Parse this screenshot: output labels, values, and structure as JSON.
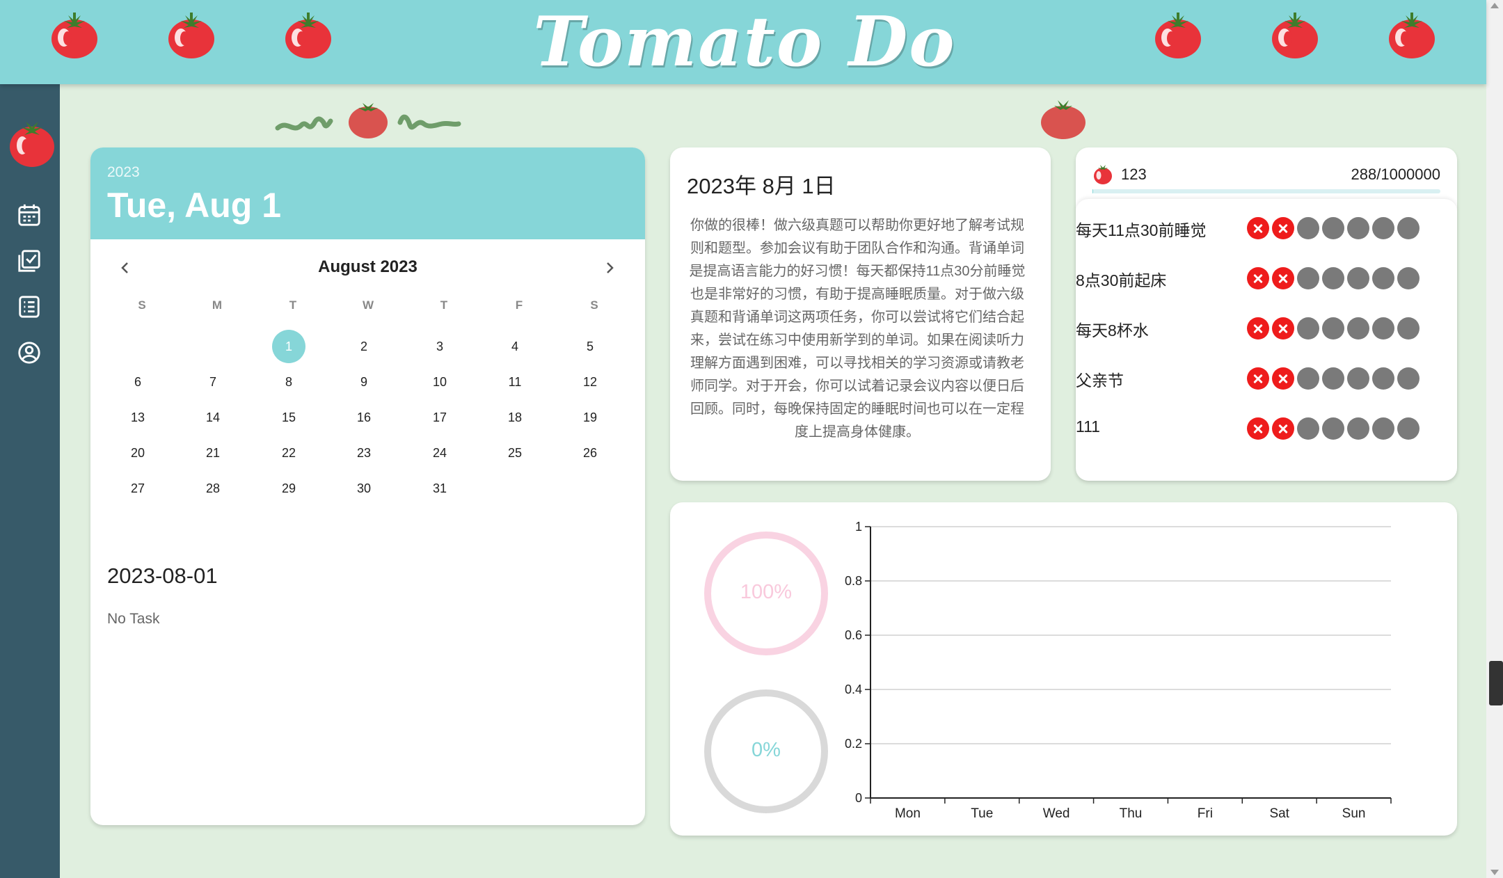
{
  "header": {
    "brand": "Tomato Do"
  },
  "sidebar": {
    "items": [
      {
        "icon": "calendar-icon"
      },
      {
        "icon": "checklist-icon"
      },
      {
        "icon": "list-icon"
      },
      {
        "icon": "user-icon"
      }
    ]
  },
  "calendar": {
    "year": "2023",
    "date_display": "Tue, Aug 1",
    "month_label": "August 2023",
    "weekdays": [
      "S",
      "M",
      "T",
      "W",
      "T",
      "F",
      "S"
    ],
    "first_weekday": 2,
    "days_in_month": 31,
    "selected_day": 1
  },
  "tasks": {
    "date": "2023-08-01",
    "empty_text": "No Task"
  },
  "advice": {
    "title": "2023年 8月 1日",
    "text": "你做的很棒！做六级真题可以帮助你更好地了解考试规则和题型。参加会议有助于团队合作和沟通。背诵单词是提高语言能力的好习惯！每天都保持11点30分前睡觉也是非常好的习惯，有助于提高睡眠质量。对于做六级真题和背诵单词这两项任务，你可以尝试将它们结合起来，尝试在练习中使用新学到的单词。如果在阅读听力理解方面遇到困难，可以寻找相关的学习资源或请教老师同学。对于开会，你可以试着记录会议内容以便日后回顾。同时，每晚保持固定的睡眠时间也可以在一定程度上提高身体健康。"
  },
  "habits": {
    "top_name": "123",
    "count_text": "288/1000000",
    "progress": 0.000288,
    "items": [
      {
        "name": "每天11点30前睡觉",
        "days": [
          "miss",
          "miss",
          "none",
          "none",
          "none",
          "none",
          "none"
        ]
      },
      {
        "name": "8点30前起床",
        "days": [
          "miss",
          "miss",
          "none",
          "none",
          "none",
          "none",
          "none"
        ]
      },
      {
        "name": "每天8杯水",
        "days": [
          "miss",
          "miss",
          "none",
          "none",
          "none",
          "none",
          "none"
        ]
      },
      {
        "name": "父亲节",
        "days": [
          "miss",
          "miss",
          "none",
          "none",
          "none",
          "none",
          "none"
        ]
      },
      {
        "name": "111",
        "days": [
          "miss",
          "miss",
          "none",
          "none",
          "none",
          "none",
          "none"
        ]
      }
    ]
  },
  "stats": {
    "rings": [
      {
        "label": "100%",
        "value": 1.0,
        "color": "#f9d3e2",
        "text_color": "#f9c9dc"
      },
      {
        "label": "0%",
        "value": 0.0,
        "color": "#d9d9d9",
        "text_color": "#86d6d8"
      }
    ]
  },
  "chart_data": {
    "type": "line",
    "categories": [
      "Mon",
      "Tue",
      "Wed",
      "Thu",
      "Fri",
      "Sat",
      "Sun"
    ],
    "y_ticks": [
      "0",
      "0.2",
      "0.4",
      "0.6",
      "0.8",
      "1"
    ],
    "ylim": [
      0,
      1
    ],
    "grid": true,
    "series": []
  },
  "colors": {
    "accent": "#86d6d8",
    "sidebar": "#375a69",
    "background": "#e0efdf",
    "miss": "#ee1c1c",
    "pending": "#7a7a7a",
    "tomato": "#e8333a"
  }
}
